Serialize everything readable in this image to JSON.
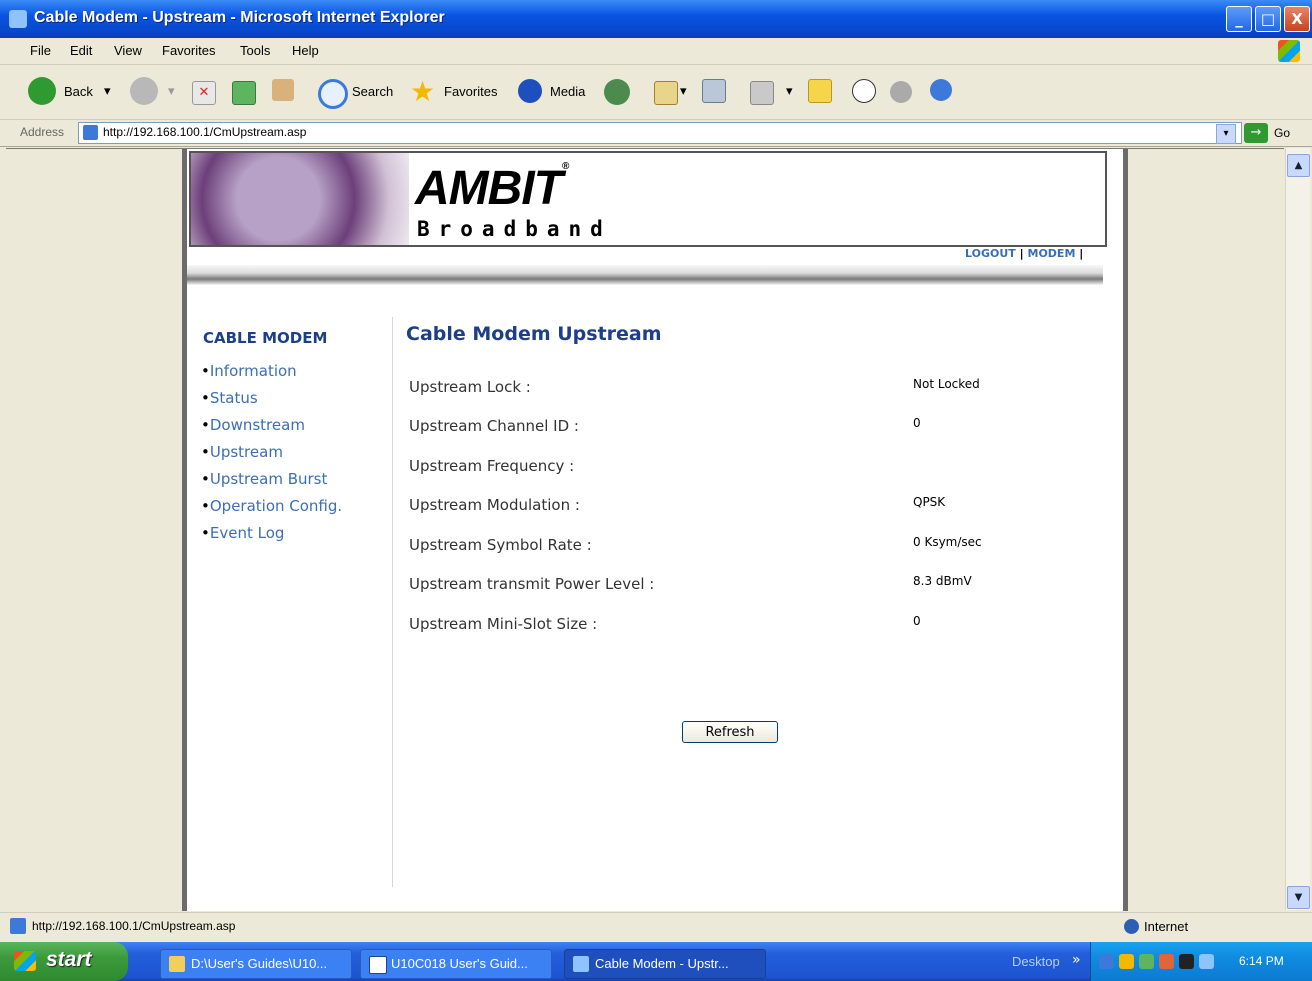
{
  "window": {
    "title": "Cable Modem - Upstream - Microsoft Internet Explorer",
    "min": "_",
    "max": "□",
    "close": "X"
  },
  "menu": [
    "File",
    "Edit",
    "View",
    "Favorites",
    "Tools",
    "Help"
  ],
  "toolbar": {
    "back": "Back",
    "search": "Search",
    "favorites": "Favorites",
    "media": "Media"
  },
  "address": {
    "label": "Address",
    "url": "http://192.168.100.1/CmUpstream.asp",
    "go": "Go"
  },
  "page": {
    "logo": "AMBIT",
    "logo_mark": "®",
    "tagline": "Broadband",
    "top_links": [
      "LOGOUT",
      "MODEM"
    ],
    "sidebar": {
      "title": "CABLE MODEM",
      "items": [
        "Information",
        "Status",
        "Downstream",
        "Upstream",
        "Upstream Burst",
        "Operation Config.",
        "Event Log"
      ]
    },
    "main": {
      "title": "Cable Modem Upstream",
      "fields": [
        {
          "label": "Upstream Lock :",
          "value": "Not Locked"
        },
        {
          "label": "Upstream Channel ID :",
          "value": "0"
        },
        {
          "label": "Upstream Frequency :",
          "value": ""
        },
        {
          "label": "Upstream Modulation :",
          "value": "QPSK"
        },
        {
          "label": "Upstream Symbol Rate :",
          "value": "0 Ksym/sec"
        },
        {
          "label": "Upstream transmit Power Level :",
          "value": "8.3 dBmV"
        },
        {
          "label": "Upstream Mini-Slot Size :",
          "value": "0"
        }
      ],
      "refresh": "Refresh"
    }
  },
  "statusbar": {
    "url": "http://192.168.100.1/CmUpstream.asp",
    "zone": "Internet"
  },
  "taskbar": {
    "start": "start",
    "tasks": [
      "D:\\User's Guides\\U10...",
      "U10C018 User's Guid...",
      "Cable Modem - Upstr..."
    ],
    "desktop": "Desktop",
    "chevron": "»",
    "clock": "6:14 PM"
  }
}
